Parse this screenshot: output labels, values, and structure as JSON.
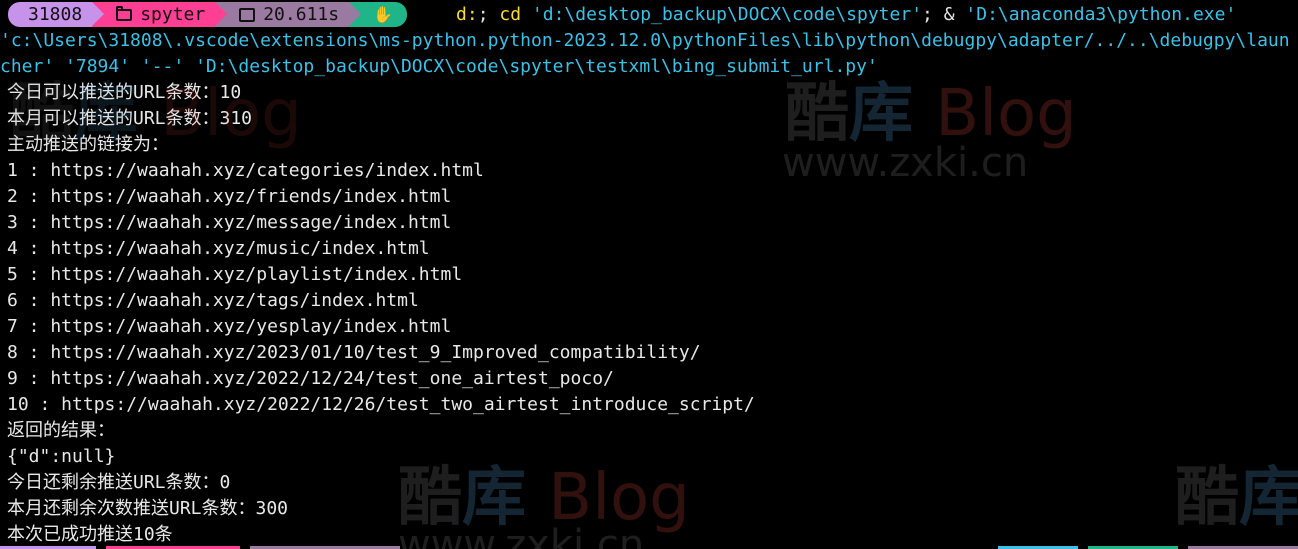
{
  "prompt": {
    "user": "31808",
    "folder": "spyter",
    "elapsed": "20.611s",
    "status_icon": "hand-icon"
  },
  "command": {
    "p1": "d:",
    "p2": "; ",
    "p3": "cd",
    "p4": " 'd:\\desktop_backup\\DOCX\\code\\spyter'",
    "p5": "; & ",
    "p6": "'D:\\anaconda3\\python.exe' 'c:\\Users\\31808\\.vscode\\extensions\\ms-python.python-2023.12.0\\pythonFiles\\lib\\python\\debugpy\\adapter/../..\\debugpy\\launcher' '7894' '--' 'D:\\desktop_backup\\DOCX\\code\\spyter\\testxml\\bing_submit_url.py'"
  },
  "output": [
    "今日可以推送的URL条数：10",
    "本月可以推送的URL条数：310",
    "主动推送的链接为：",
    "1 : https://waahah.xyz/categories/index.html",
    "2 : https://waahah.xyz/friends/index.html",
    "3 : https://waahah.xyz/message/index.html",
    "4 : https://waahah.xyz/music/index.html",
    "5 : https://waahah.xyz/playlist/index.html",
    "6 : https://waahah.xyz/tags/index.html",
    "7 : https://waahah.xyz/yesplay/index.html",
    "8 : https://waahah.xyz/2023/01/10/test_9_Improved_compatibility/",
    "9 : https://waahah.xyz/2022/12/24/test_one_airtest_poco/",
    "10 : https://waahah.xyz/2022/12/26/test_two_airtest_introduce_script/",
    "返回的结果：",
    "{\"d\":null}",
    "今日还剩余推送URL条数：0",
    "本月还剩余次数推送URL条数：300",
    "本次已成功推送10条"
  ],
  "watermark": {
    "k1": "酷",
    "k2": "库",
    "blog": "Blog",
    "url": "www.zxki.cn"
  },
  "colors": {
    "user_segment": "#c792ea",
    "path_segment": "#ff3f94",
    "time_segment": "#9a7aa0",
    "status_segment": "#20b589",
    "command_keyword": "#ffd93a",
    "command_string": "#3ec0e6",
    "background": "#000000"
  }
}
